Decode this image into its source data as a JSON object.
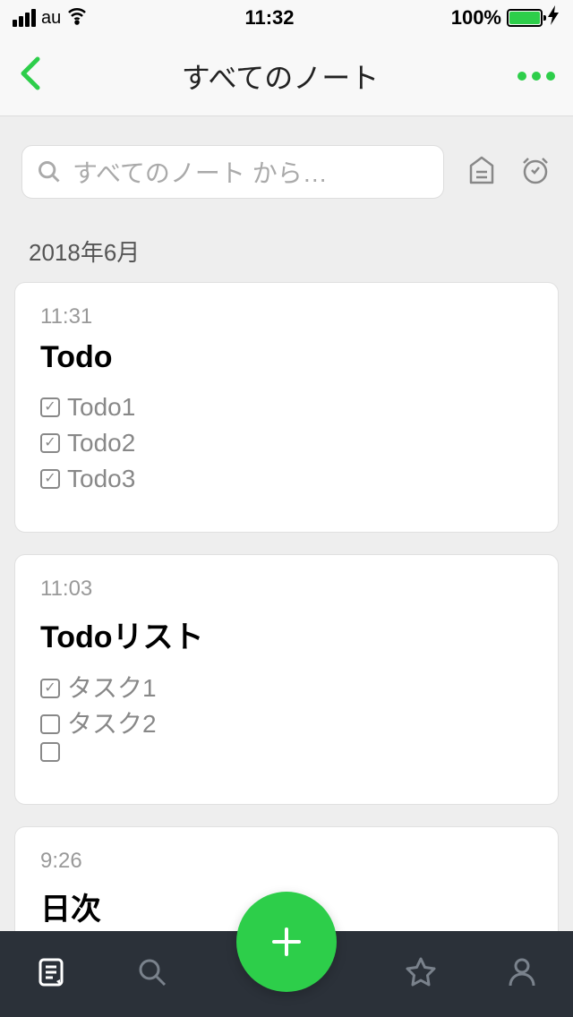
{
  "status": {
    "carrier": "au",
    "time": "11:32",
    "battery_pct": "100%"
  },
  "header": {
    "title": "すべてのノート"
  },
  "search": {
    "placeholder": "すべてのノート から…"
  },
  "section": {
    "label": "2018年6月"
  },
  "notes": [
    {
      "time": "11:31",
      "title": "Todo",
      "items": [
        {
          "checked": true,
          "text": "Todo1"
        },
        {
          "checked": true,
          "text": "Todo2"
        },
        {
          "checked": true,
          "text": "Todo3"
        }
      ]
    },
    {
      "time": "11:03",
      "title": "Todoリスト",
      "items": [
        {
          "checked": true,
          "text": "タスク1"
        },
        {
          "checked": false,
          "text": "タスク2"
        },
        {
          "checked": false,
          "text": ""
        }
      ]
    },
    {
      "time": "9:26",
      "title": "日次"
    }
  ],
  "colors": {
    "accent": "#2dce4a",
    "tabbar": "#2b3139"
  }
}
